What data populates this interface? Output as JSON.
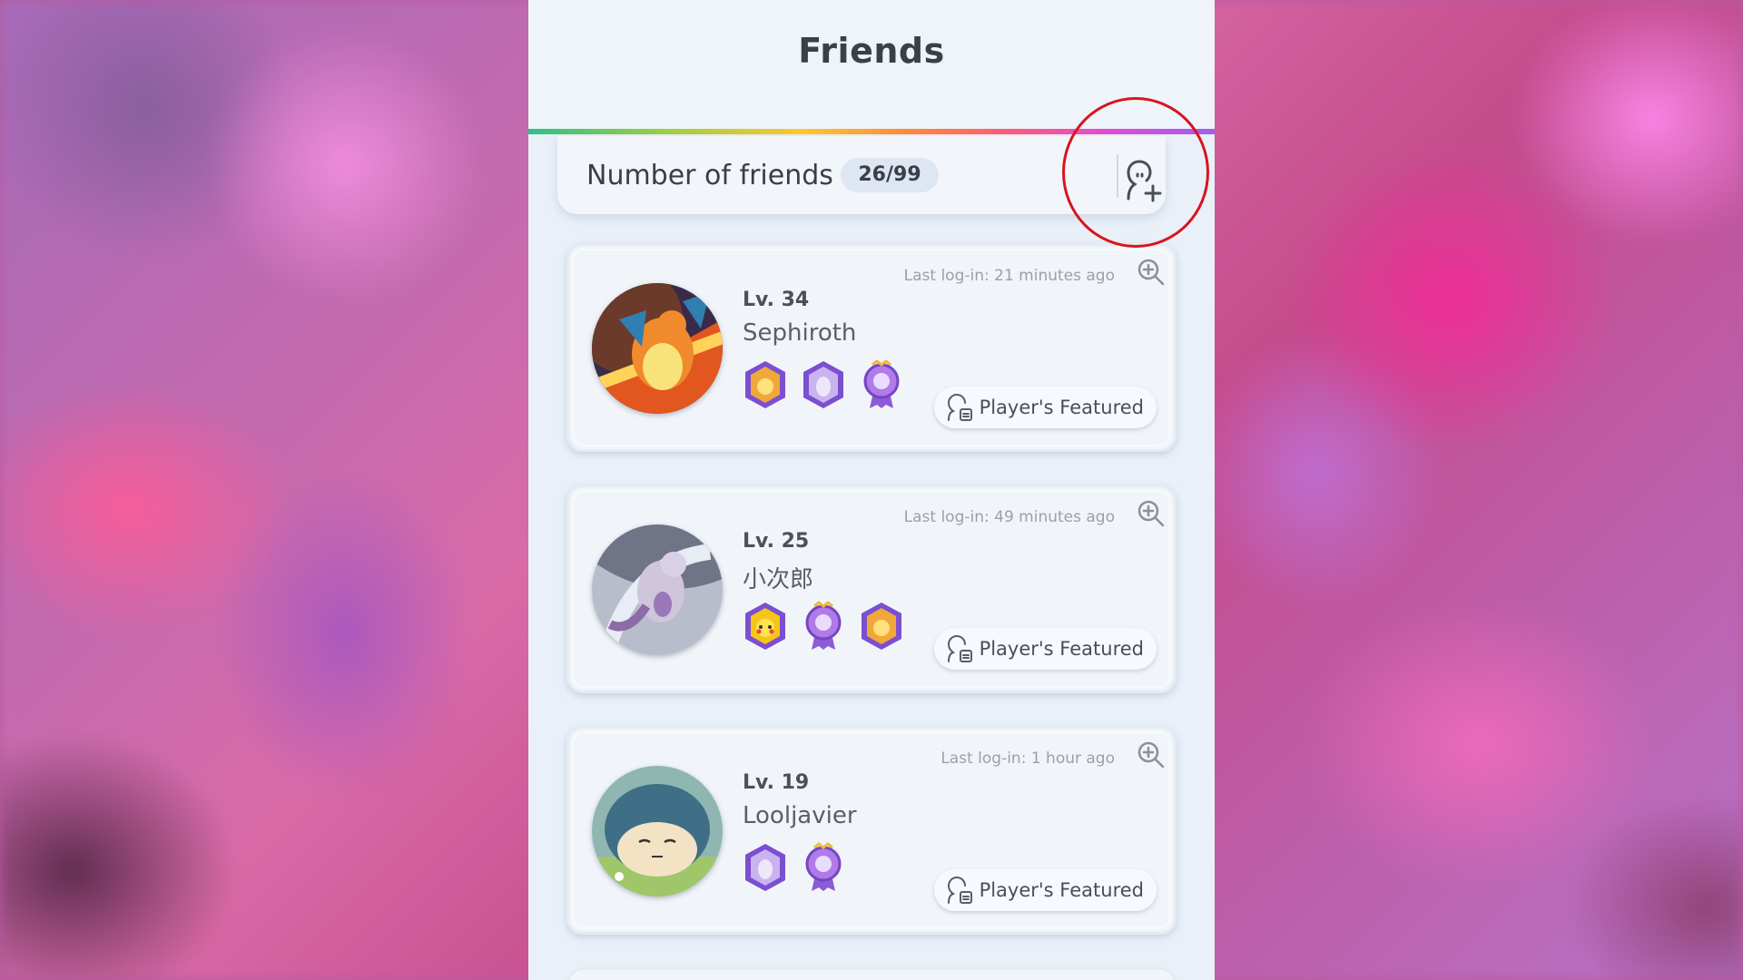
{
  "header": {
    "title": "Friends"
  },
  "friend_count": {
    "label": "Number of friends",
    "value": "26/99"
  },
  "add_friend_icon": "person-add-icon",
  "colors": {
    "highlight_circle": "#d8141e",
    "accent_rainbow": [
      "#2fc08a",
      "#ffc72e",
      "#ff5a7a",
      "#a45cf0"
    ]
  },
  "friends": [
    {
      "level": "Lv. 34",
      "name": "Sephiroth",
      "last_login": "Last log-in: 21 minutes ago",
      "avatar": "charizard-avatar",
      "badges": [
        "gold-hex-badge",
        "purple-hex-badge",
        "ribbon-medal-badge"
      ],
      "featured_label": "Player's Featured"
    },
    {
      "level": "Lv. 25",
      "name": "小次郎",
      "last_login": "Last log-in: 49 minutes ago",
      "avatar": "mewtwo-avatar",
      "badges": [
        "pikachu-hex-badge",
        "ribbon-medal-badge",
        "gold-hex-badge"
      ],
      "featured_label": "Player's Featured"
    },
    {
      "level": "Lv. 19",
      "name": "Looljavier",
      "last_login": "Last log-in: 1 hour ago",
      "avatar": "snorlax-avatar",
      "badges": [
        "purple-hex-badge",
        "ribbon-medal-badge"
      ],
      "featured_label": "Player's Featured"
    }
  ]
}
